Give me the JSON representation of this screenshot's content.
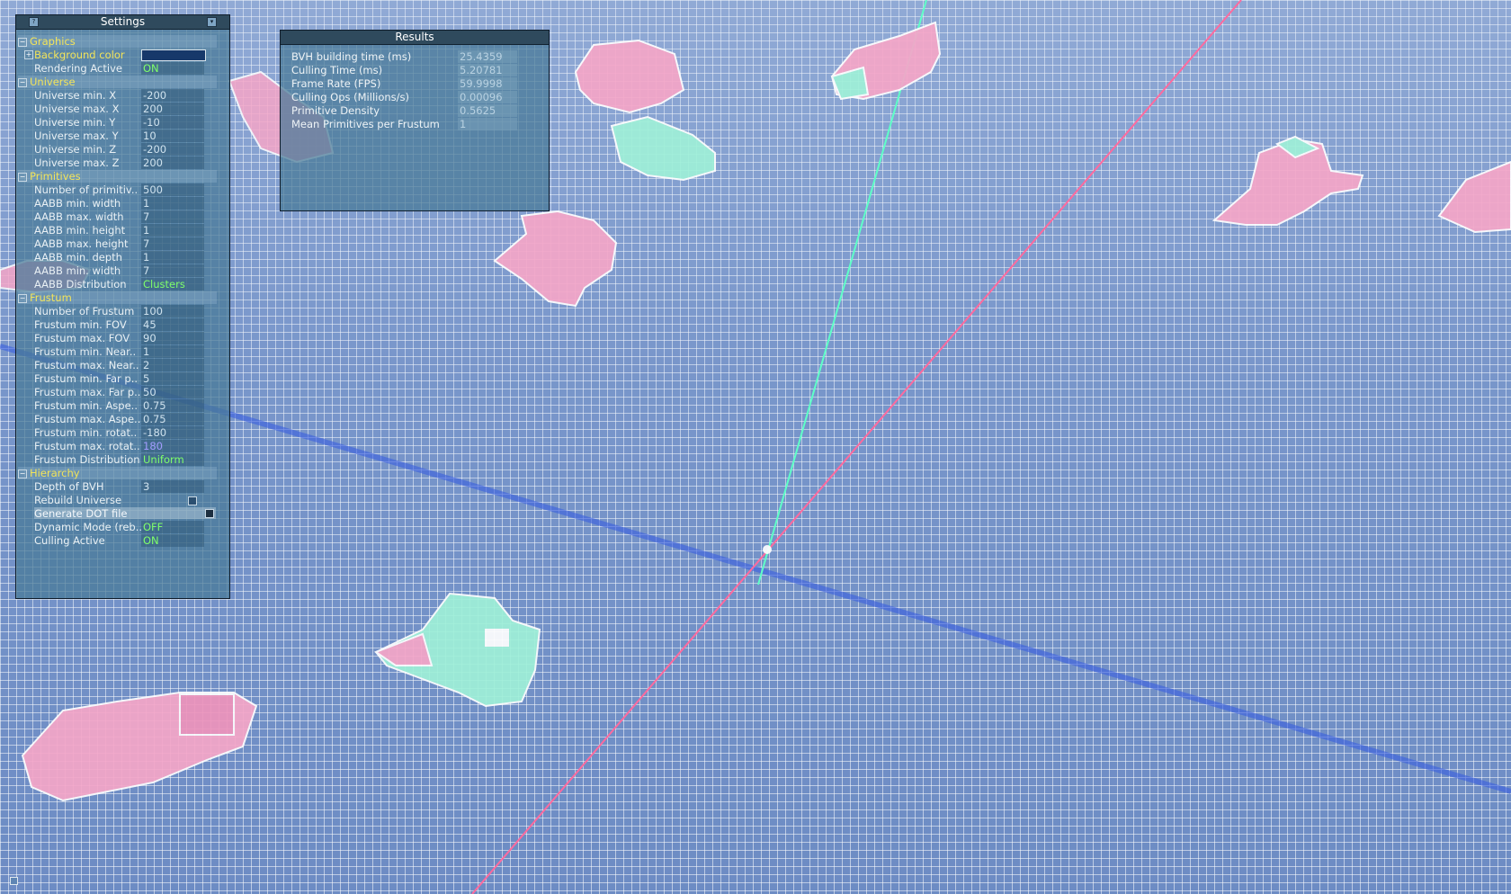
{
  "settings": {
    "title": "Settings",
    "groups": [
      {
        "name": "Graphics",
        "rows": [
          {
            "label": "Background color",
            "value": "",
            "type": "color",
            "expand": "+"
          },
          {
            "label": "Rendering Active",
            "value": "ON",
            "type": "green"
          }
        ]
      },
      {
        "name": "Universe",
        "rows": [
          {
            "label": "Universe min. X",
            "value": "-200"
          },
          {
            "label": "Universe max. X",
            "value": "200"
          },
          {
            "label": "Universe min. Y",
            "value": "-10"
          },
          {
            "label": "Universe max. Y",
            "value": "10"
          },
          {
            "label": "Universe min. Z",
            "value": "-200"
          },
          {
            "label": "Universe max. Z",
            "value": "200"
          }
        ]
      },
      {
        "name": "Primitives",
        "rows": [
          {
            "label": "Number of primitiv..",
            "value": "500"
          },
          {
            "label": "AABB min. width",
            "value": "1"
          },
          {
            "label": "AABB max. width",
            "value": "7"
          },
          {
            "label": "AABB min. height",
            "value": "1"
          },
          {
            "label": "AABB max. height",
            "value": "7"
          },
          {
            "label": "AABB min. depth",
            "value": "1"
          },
          {
            "label": "AABB min. width",
            "value": "7"
          },
          {
            "label": "AABB Distribution",
            "value": "Clusters",
            "type": "green"
          }
        ]
      },
      {
        "name": "Frustum",
        "rows": [
          {
            "label": "Number of Frustum",
            "value": "100"
          },
          {
            "label": "Frustum min. FOV",
            "value": "45"
          },
          {
            "label": "Frustum max. FOV",
            "value": "90"
          },
          {
            "label": "Frustum min. Near..",
            "value": "1"
          },
          {
            "label": "Frustum max. Near..",
            "value": "2"
          },
          {
            "label": "Frustum min. Far p..",
            "value": "5"
          },
          {
            "label": "Frustum max. Far p..",
            "value": "50"
          },
          {
            "label": "Frustum min. Aspe..",
            "value": "0.75"
          },
          {
            "label": "Frustum max. Aspe..",
            "value": "0.75"
          },
          {
            "label": "Frustum min. rotat..",
            "value": "-180"
          },
          {
            "label": "Frustum max. rotat..",
            "value": "180",
            "type": "purple"
          },
          {
            "label": "Frustum Distribution",
            "value": "Uniform",
            "type": "green"
          }
        ]
      },
      {
        "name": "Hierarchy",
        "rows": [
          {
            "label": "Depth of BVH",
            "value": "3"
          },
          {
            "label": "Rebuild Universe",
            "value": "",
            "type": "check"
          },
          {
            "label": "Generate DOT file",
            "value": "",
            "type": "button"
          },
          {
            "label": "Dynamic Mode (reb..",
            "value": "OFF",
            "type": "green"
          },
          {
            "label": "Culling Active",
            "value": "ON",
            "type": "green"
          }
        ]
      }
    ]
  },
  "results": {
    "title": "Results",
    "rows": [
      {
        "label": "BVH building time (ms)",
        "value": "25.4359"
      },
      {
        "label": "Culling Time (ms)",
        "value": "5.20781"
      },
      {
        "label": "Frame Rate (FPS)",
        "value": "59.9998"
      },
      {
        "label": "Culling Ops (Millions/s)",
        "value": "0.00096"
      },
      {
        "label": "Primitive Density",
        "value": "0.5625"
      },
      {
        "label": "Mean Primitives per Frustum",
        "value": "1"
      }
    ]
  },
  "colors": {
    "grid_background": "#6d8cc4",
    "panel": "#46788f",
    "group_label": "#f3e45a",
    "value_on": "#7fff6a",
    "axis_x": "#ff6a9e",
    "axis_y": "#5fffc8",
    "axis_z": "#3a5fe0",
    "cluster_pink": "#f5a6c8",
    "cluster_cyan": "#9ff0d8"
  }
}
